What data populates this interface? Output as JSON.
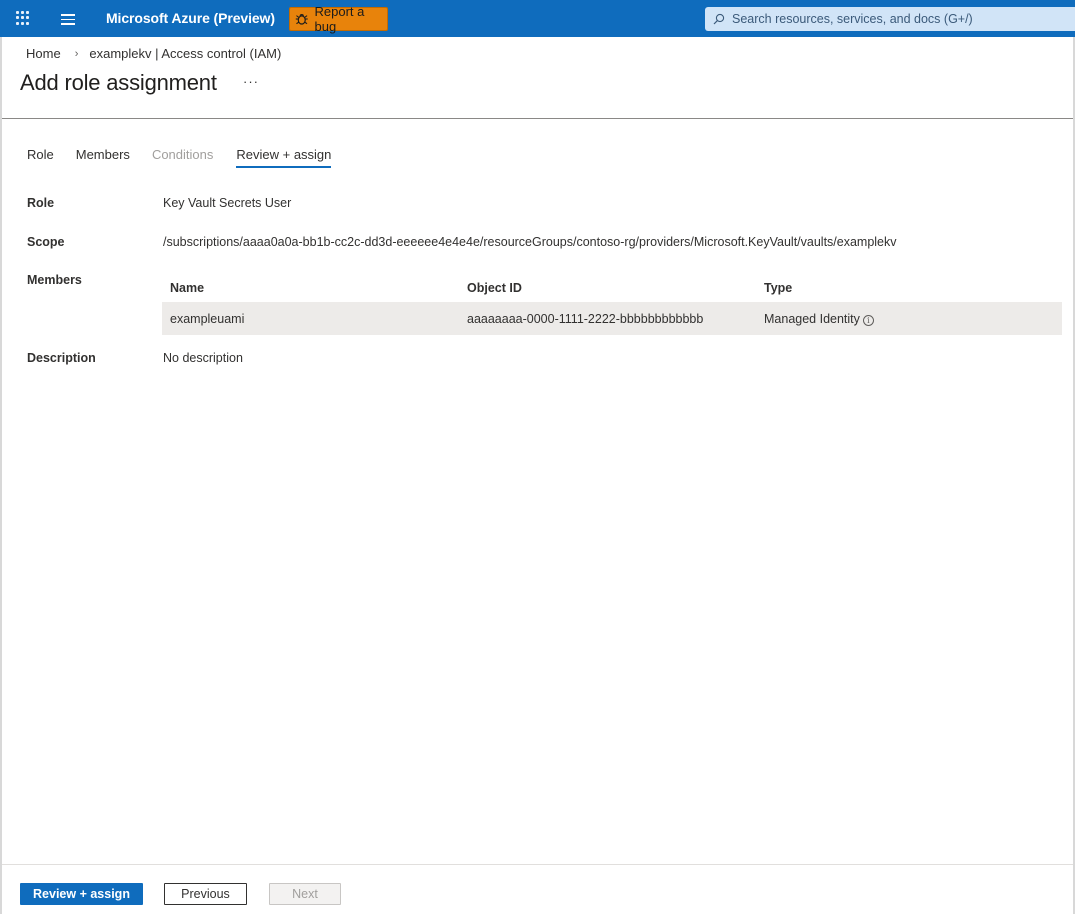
{
  "topbar": {
    "title": "Microsoft Azure (Preview)",
    "report_bug_label": "Report a bug",
    "search_placeholder": "Search resources, services, and docs (G+/)",
    "brand_color": "#0f6cbd",
    "bug_color": "#e8830b"
  },
  "breadcrumb": {
    "items": [
      "Home",
      "examplekv | Access control (IAM)"
    ]
  },
  "page": {
    "title": "Add role assignment",
    "more_label": "···"
  },
  "tabs": [
    {
      "label": "Role",
      "state": "normal"
    },
    {
      "label": "Members",
      "state": "normal"
    },
    {
      "label": "Conditions",
      "state": "disabled"
    },
    {
      "label": "Review + assign",
      "state": "active"
    }
  ],
  "details": {
    "role_label": "Role",
    "role_value": "Key Vault Secrets User",
    "scope_label": "Scope",
    "scope_value": "/subscriptions/aaaa0a0a-bb1b-cc2c-dd3d-eeeeee4e4e4e/resourceGroups/contoso-rg/providers/Microsoft.KeyVault/vaults/examplekv",
    "members_label": "Members",
    "description_label": "Description",
    "description_value": "No description"
  },
  "members_table": {
    "columns": [
      "Name",
      "Object ID",
      "Type"
    ],
    "rows": [
      {
        "name": "exampleuami",
        "object_id": "aaaaaaaa-0000-1111-2222-bbbbbbbbbbbb",
        "type": "Managed Identity"
      }
    ]
  },
  "footer": {
    "review_assign_label": "Review + assign",
    "previous_label": "Previous",
    "next_label": "Next"
  }
}
